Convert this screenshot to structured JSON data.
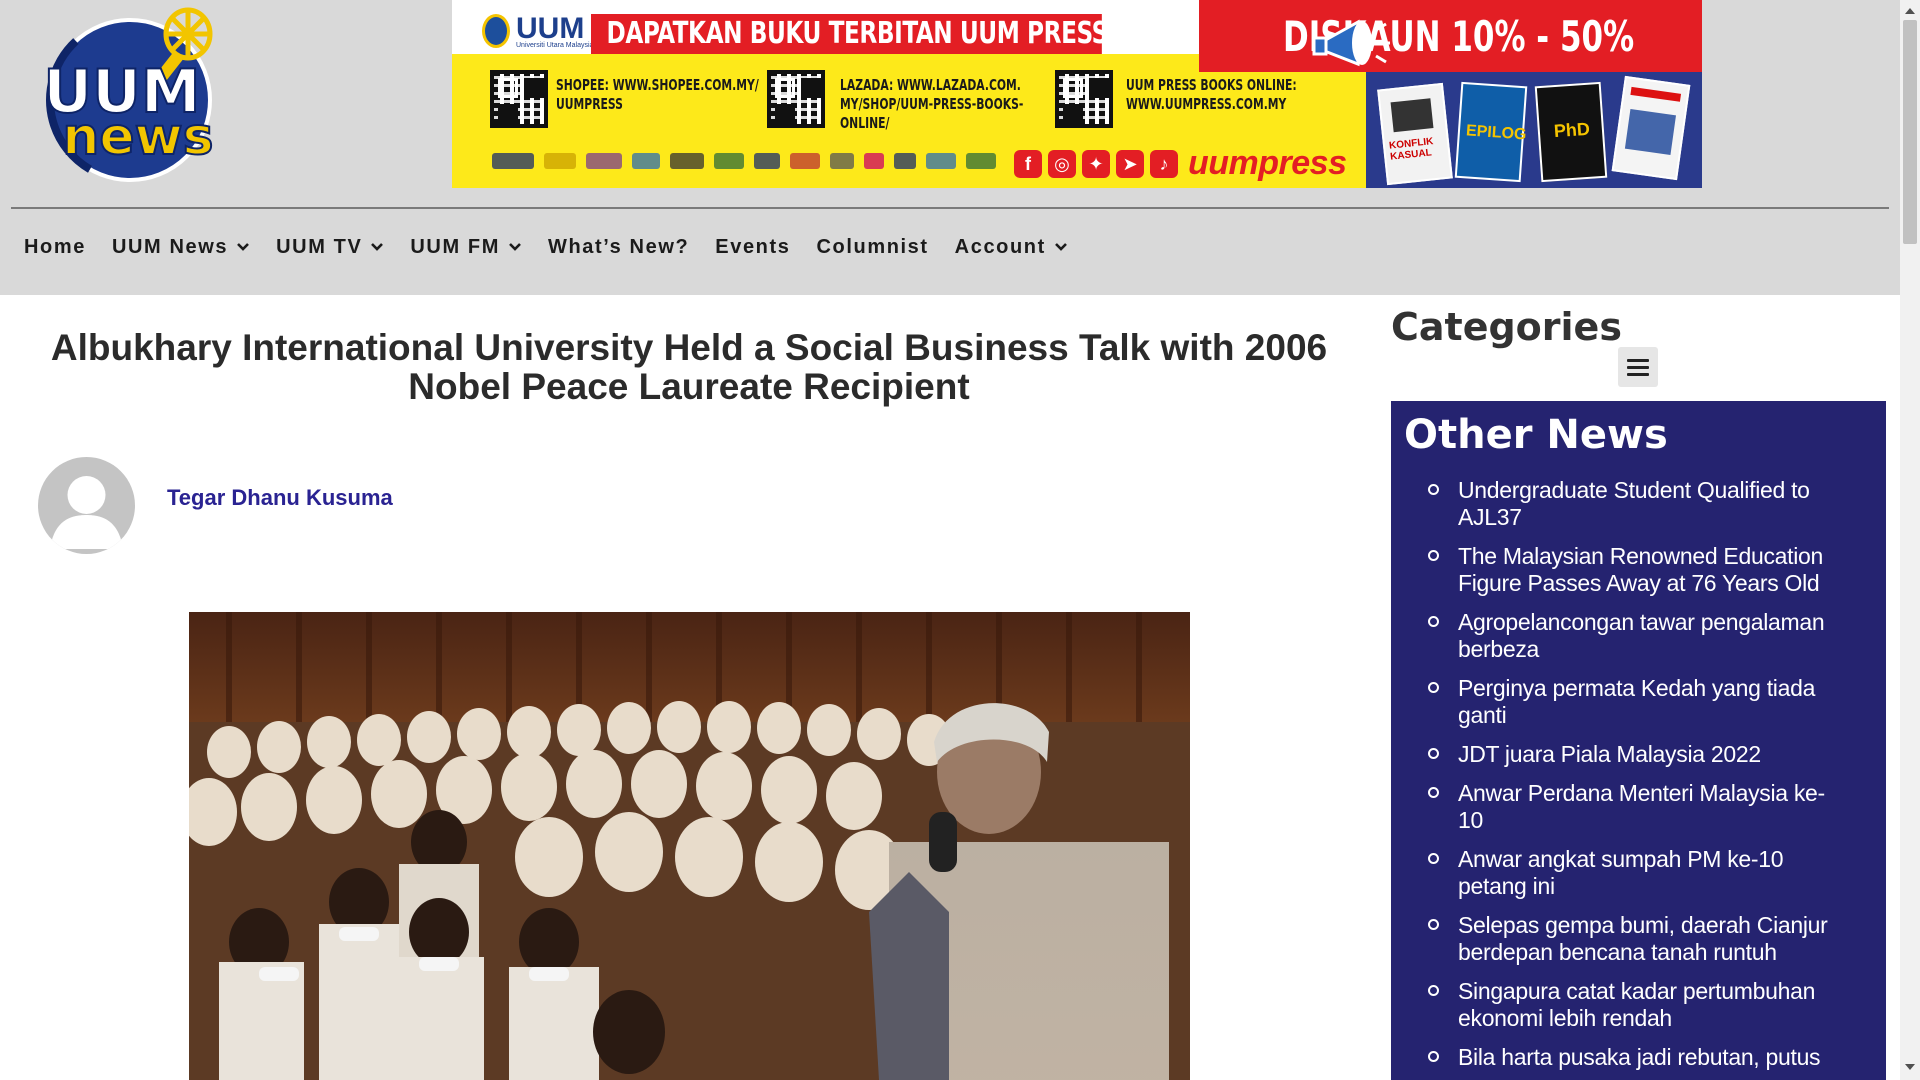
{
  "site": {
    "logo_line1": "UUM",
    "logo_line2": "news"
  },
  "banner": {
    "badge_text": "UUM",
    "badge_sub": "Universiti Utara Malaysia",
    "headline": "DAPATKAN BUKU TERBITAN UUM PRESS DALAM TALIAN DI:",
    "discount": "DISKAUN 10% - 50%",
    "shopee": "SHOPEE: WWW.SHOPEE.COM.MY/\nUUMPRESS",
    "lazada": "LAZADA: WWW.LAZADA.COM.\nMY/SHOP/UUM-PRESS-BOOKS-\nONLINE/",
    "online": "UUM PRESS BOOKS ONLINE:\nWWW.UUMPRESS.COM.MY",
    "brand": "uumpress",
    "book_titles": [
      "KONFLIK KASUAL",
      "EPILOG",
      "PhD",
      ""
    ],
    "colors": {
      "yellow": "#fde91a",
      "red": "#e31e24",
      "navy": "#2a3a8c"
    }
  },
  "nav": {
    "items": [
      {
        "label": "Home",
        "dropdown": false
      },
      {
        "label": "UUM News",
        "dropdown": true
      },
      {
        "label": "UUM TV",
        "dropdown": true
      },
      {
        "label": "UUM FM",
        "dropdown": true
      },
      {
        "label": "What’s New?",
        "dropdown": false
      },
      {
        "label": "Events",
        "dropdown": false
      },
      {
        "label": "Columnist",
        "dropdown": false
      },
      {
        "label": "Account",
        "dropdown": true
      }
    ]
  },
  "article": {
    "title": "Albukhary International University Held a Social Business Talk with 2006 Nobel Peace Laureate Recipient",
    "author": "Tegar Dhanu Kusuma"
  },
  "sidebar": {
    "categories_title": "Categories",
    "other_news_title": "Other News",
    "accent_color": "#252370",
    "news": [
      "Undergraduate Student Qualified to AJL37",
      "The Malaysian Renowned Education Figure Passes Away at 76 Years Old",
      "Agropelancongan tawar pengalaman berbeza",
      "Perginya permata Kedah yang tiada ganti",
      "JDT juara Piala Malaysia 2022",
      "Anwar Perdana Menteri Malaysia ke-10",
      "Anwar angkat sumpah PM ke-10 petang ini",
      "Selepas gempa bumi, daerah Cianjur berdepan bencana tanah runtuh",
      "Singapura catat kadar pertumbuhan ekonomi lebih rendah",
      "Bila harta pusaka jadi rebutan, putus"
    ]
  }
}
